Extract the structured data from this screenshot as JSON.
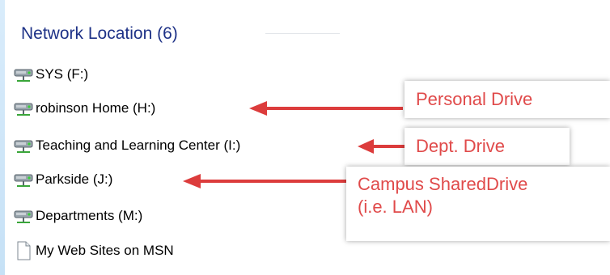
{
  "group": {
    "title": "Network Location (6)"
  },
  "items": [
    {
      "label": "SYS (F:)",
      "icon": "network-drive-icon"
    },
    {
      "label": "robinson Home (H:)",
      "icon": "network-drive-icon"
    },
    {
      "label": "Teaching and Learning Center (I:)",
      "icon": "network-drive-icon"
    },
    {
      "label": "Parkside (J:)",
      "icon": "network-drive-icon"
    },
    {
      "label": "Departments (M:)",
      "icon": "network-drive-icon"
    },
    {
      "label": "My Web Sites on MSN",
      "icon": "document-icon"
    }
  ],
  "callouts": {
    "personal": {
      "text": "Personal Drive"
    },
    "dept": {
      "text": "Dept. Drive"
    },
    "campus": {
      "line1": "Campus SharedDrive",
      "line2": "(i.e. LAN)"
    }
  },
  "colors": {
    "header_text": "#1e3287",
    "callout_text": "#e04a4a",
    "arrow": "#dc3c3c",
    "side_gradient": "#cfe6f8"
  }
}
